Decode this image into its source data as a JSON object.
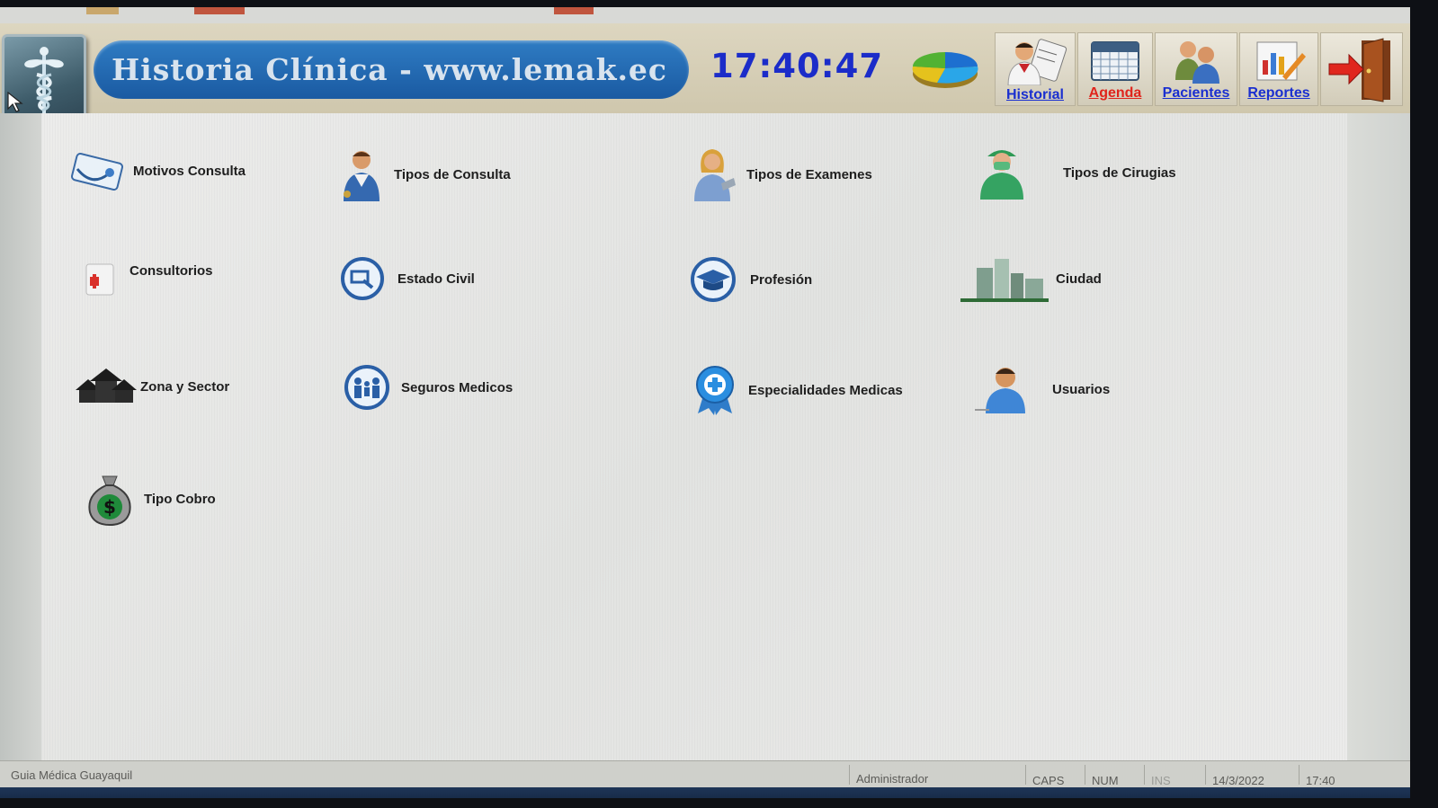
{
  "header": {
    "title": "Historia Clínica - www.lemak.ec",
    "clock": "17:40:47"
  },
  "nav": [
    {
      "label": "Historial",
      "color": "#1a2fd0",
      "icon": "doctor-chart-icon"
    },
    {
      "label": "Agenda",
      "color": "#e0241c",
      "icon": "calendar-icon"
    },
    {
      "label": "Pacientes",
      "color": "#1a2fd0",
      "icon": "patients-icon"
    },
    {
      "label": "Reportes",
      "color": "#1a2fd0",
      "icon": "reports-icon"
    },
    {
      "label": "",
      "icon": "exit-door-icon"
    }
  ],
  "menu": {
    "motivos_consulta": "Motivos Consulta",
    "tipos_consulta": "Tipos de Consulta",
    "tipos_examenes": "Tipos de Examenes",
    "tipos_cirugias": "Tipos de Cirugias",
    "consultorios": "Consultorios",
    "estado_civil": "Estado Civil",
    "profesion": "Profesión",
    "ciudad": "Ciudad",
    "zona_sector": "Zona y Sector",
    "seguros_medicos": "Seguros Medicos",
    "especialidades_medicas": "Especialidades Medicas",
    "usuarios": "Usuarios",
    "tipo_cobro": "Tipo Cobro"
  },
  "status": {
    "app_name": "Guia Médica Guayaquil",
    "user": "Administrador",
    "caps": "CAPS",
    "num": "NUM",
    "ins": "INS",
    "date": "14/3/2022",
    "time": "17:40"
  }
}
